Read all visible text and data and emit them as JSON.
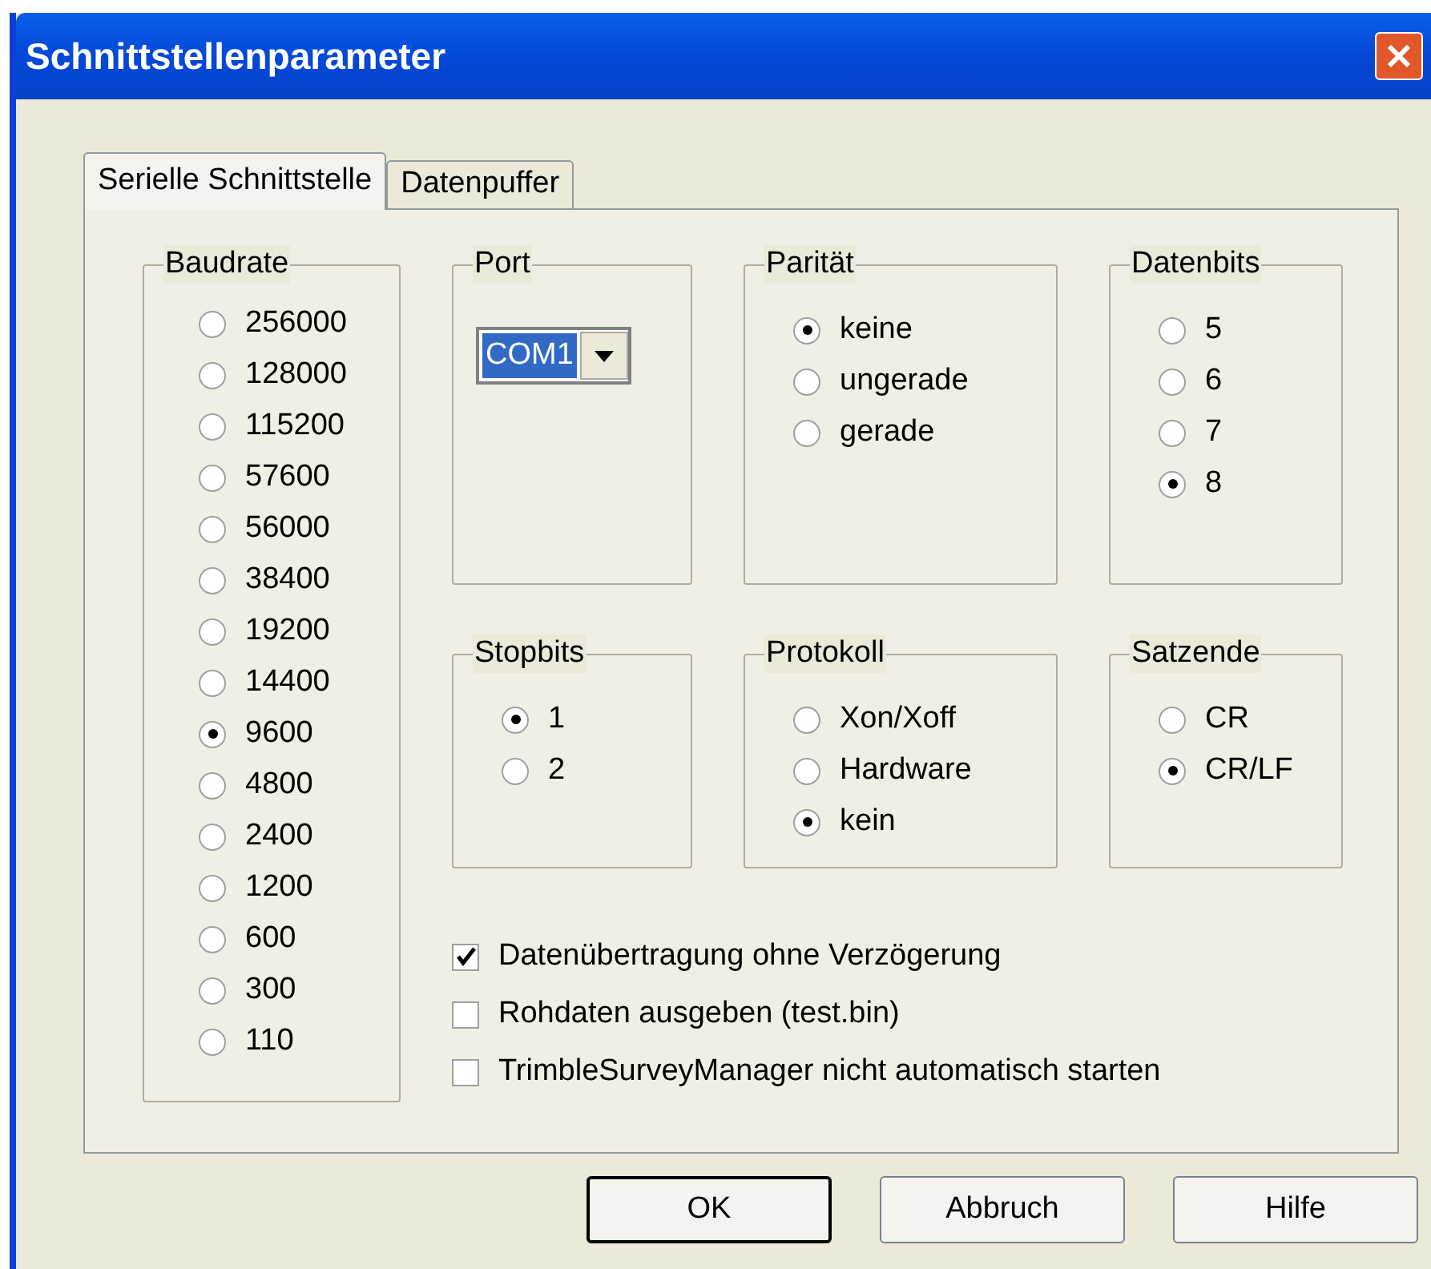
{
  "window": {
    "title": "Schnittstellenparameter"
  },
  "tabs": [
    {
      "label": "Serielle Schnittstelle",
      "selected": true
    },
    {
      "label": "Datenpuffer",
      "selected": false
    }
  ],
  "baudrate": {
    "label": "Baudrate",
    "options": [
      {
        "label": "256000",
        "selected": false
      },
      {
        "label": "128000",
        "selected": false
      },
      {
        "label": "115200",
        "selected": false
      },
      {
        "label": "57600",
        "selected": false
      },
      {
        "label": "56000",
        "selected": false
      },
      {
        "label": "38400",
        "selected": false
      },
      {
        "label": "19200",
        "selected": false
      },
      {
        "label": "14400",
        "selected": false
      },
      {
        "label": "9600",
        "selected": true
      },
      {
        "label": "4800",
        "selected": false
      },
      {
        "label": "2400",
        "selected": false
      },
      {
        "label": "1200",
        "selected": false
      },
      {
        "label": "600",
        "selected": false
      },
      {
        "label": "300",
        "selected": false
      },
      {
        "label": "110",
        "selected": false
      }
    ]
  },
  "groups": [
    {
      "kind": "dropdown",
      "label": "Port",
      "value": "COM1"
    },
    {
      "kind": "radio",
      "label": "Parität",
      "options": [
        {
          "label": "keine",
          "selected": true
        },
        {
          "label": "ungerade",
          "selected": false
        },
        {
          "label": "gerade",
          "selected": false
        }
      ]
    },
    {
      "kind": "radio",
      "label": "Datenbits",
      "options": [
        {
          "label": "5",
          "selected": false
        },
        {
          "label": "6",
          "selected": false
        },
        {
          "label": "7",
          "selected": false
        },
        {
          "label": "8",
          "selected": true
        }
      ]
    },
    {
      "kind": "radio",
      "label": "Stopbits",
      "options": [
        {
          "label": "1",
          "selected": true
        },
        {
          "label": "2",
          "selected": false
        }
      ]
    },
    {
      "kind": "radio",
      "label": "Protokoll",
      "options": [
        {
          "label": "Xon/Xoff",
          "selected": false
        },
        {
          "label": "Hardware",
          "selected": false
        },
        {
          "label": "kein",
          "selected": true
        }
      ]
    },
    {
      "kind": "radio",
      "label": "Satzende",
      "options": [
        {
          "label": "CR",
          "selected": false
        },
        {
          "label": "CR/LF",
          "selected": true
        }
      ]
    }
  ],
  "checkboxes": [
    {
      "label": "Datenübertragung ohne Verzögerung",
      "checked": true
    },
    {
      "label": "Rohdaten ausgeben (test.bin)",
      "checked": false
    },
    {
      "label": "TrimbleSurveyManager nicht automatisch starten",
      "checked": false
    }
  ],
  "buttons": [
    {
      "label": "OK",
      "default": true
    },
    {
      "label": "Abbruch",
      "default": false
    },
    {
      "label": "Hilfe",
      "default": false
    }
  ]
}
